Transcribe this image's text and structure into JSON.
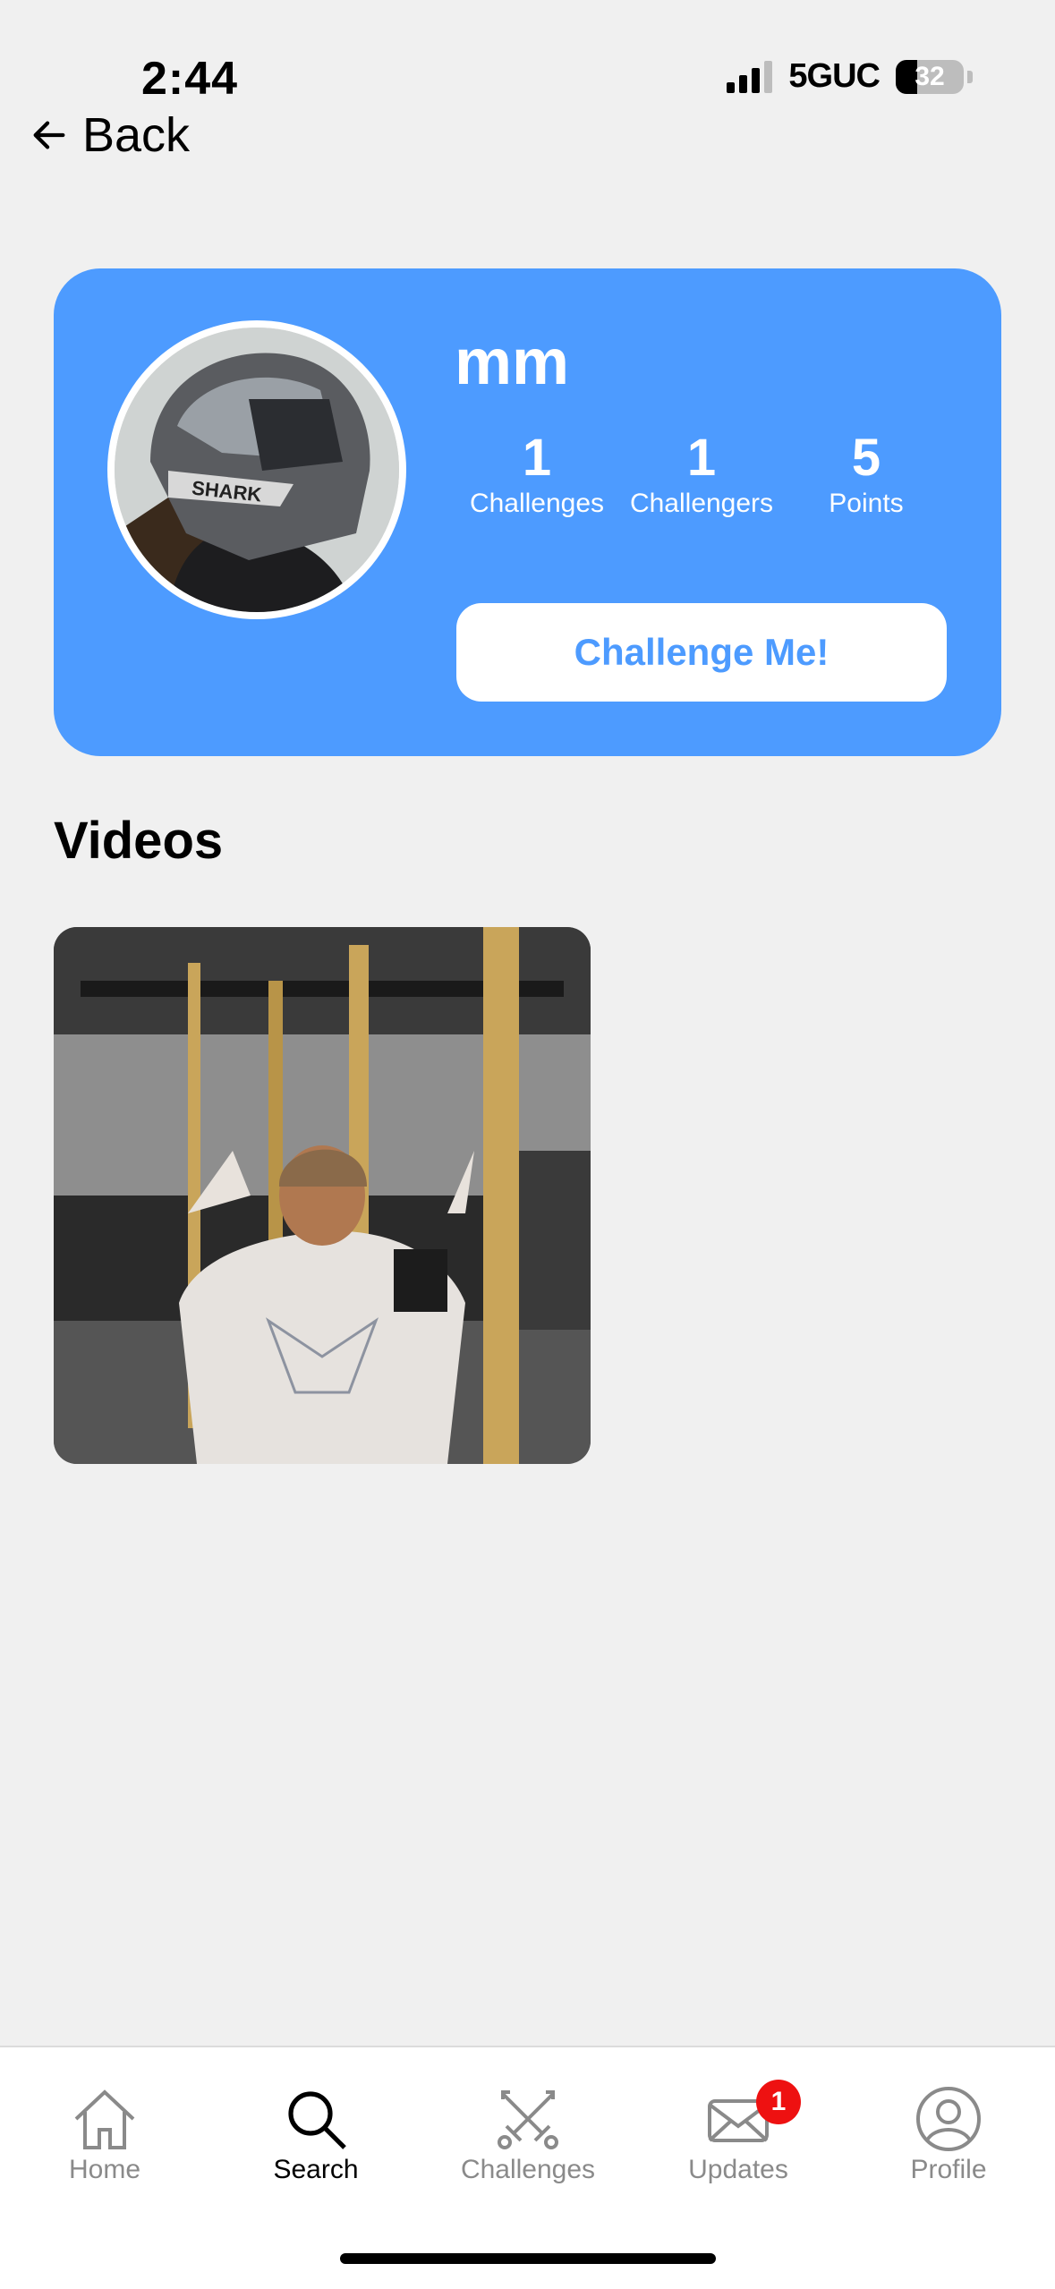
{
  "status_bar": {
    "time": "2:44",
    "network": "5GUC",
    "battery": "32",
    "battery_level": 0.32
  },
  "nav": {
    "back_label": "Back"
  },
  "profile": {
    "username": "mm",
    "stats": [
      {
        "value": "1",
        "label": "Challenges"
      },
      {
        "value": "1",
        "label": "Challengers"
      },
      {
        "value": "5",
        "label": "Points"
      }
    ],
    "challenge_button": "Challenge Me!",
    "helmet_text": "SHARK",
    "accent_color": "#4d9bff"
  },
  "videos": {
    "title": "Videos",
    "count": 1
  },
  "tabbar": {
    "items": [
      {
        "label": "Home",
        "icon": "home-icon"
      },
      {
        "label": "Search",
        "icon": "search-icon"
      },
      {
        "label": "Challenges",
        "icon": "crossed-swords-icon"
      },
      {
        "label": "Updates",
        "icon": "mail-icon",
        "badge": "1"
      },
      {
        "label": "Profile",
        "icon": "person-icon"
      }
    ],
    "active": "Search"
  }
}
